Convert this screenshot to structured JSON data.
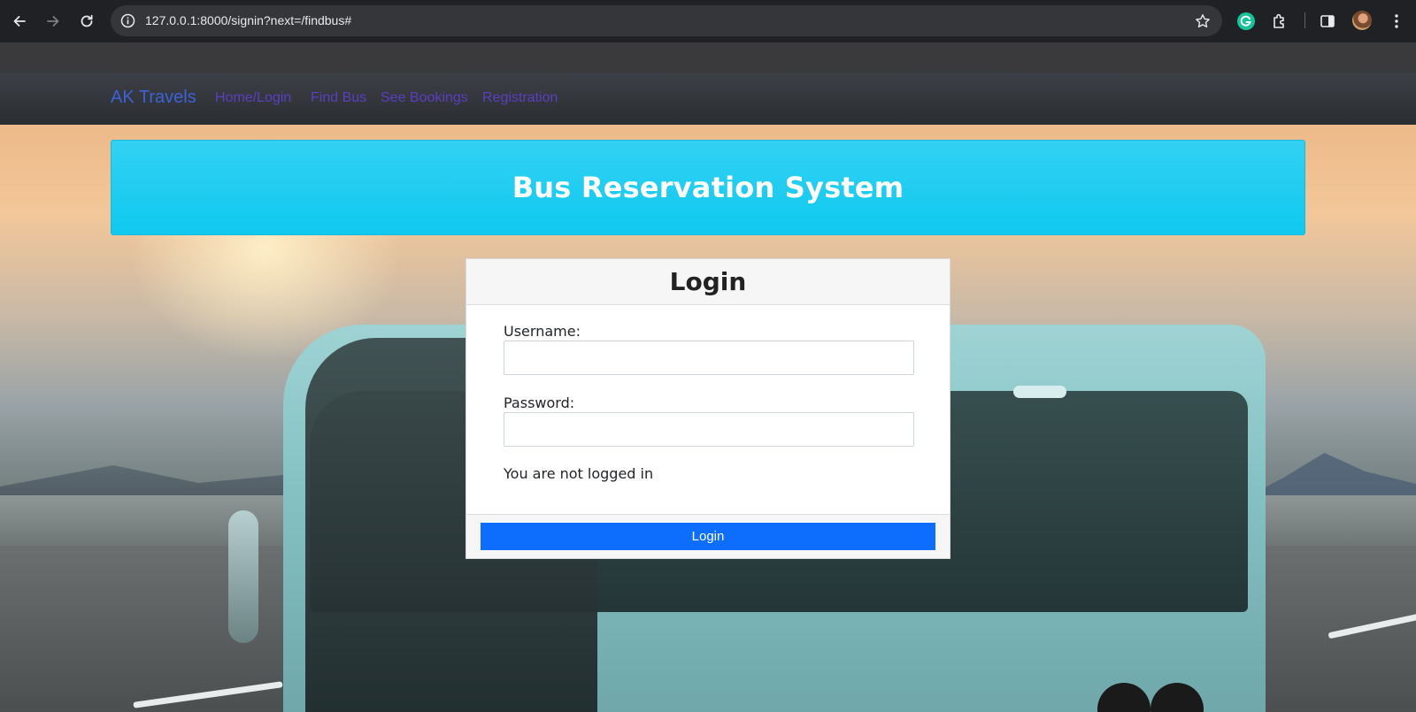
{
  "browser": {
    "url": "127.0.0.1:8000/signin?next=/findbus#",
    "back_icon": "arrow-left-icon",
    "forward_icon": "arrow-right-icon",
    "reload_icon": "reload-icon",
    "site_info_icon": "info-icon",
    "bookmark_icon": "star-icon",
    "extensions": [
      "grammarly-icon",
      "puzzle-icon",
      "side-panel-icon"
    ],
    "menu_icon": "kebab-menu-icon"
  },
  "navbar": {
    "brand": "AK Travels",
    "links": [
      {
        "label": "Home/Login"
      },
      {
        "label": "Find Bus"
      },
      {
        "label": "See Bookings"
      },
      {
        "label": "Registration"
      }
    ],
    "brand_color": "#3d61d6",
    "link_color": "#5a3fc0"
  },
  "banner": {
    "title": "Bus Reservation System",
    "color": "#0fc9ef"
  },
  "login": {
    "title": "Login",
    "username_label": "Username:",
    "username_value": "",
    "password_label": "Password:",
    "password_value": "",
    "status": "You are not logged in",
    "submit_label": "Login",
    "submit_color": "#0d6efd"
  }
}
